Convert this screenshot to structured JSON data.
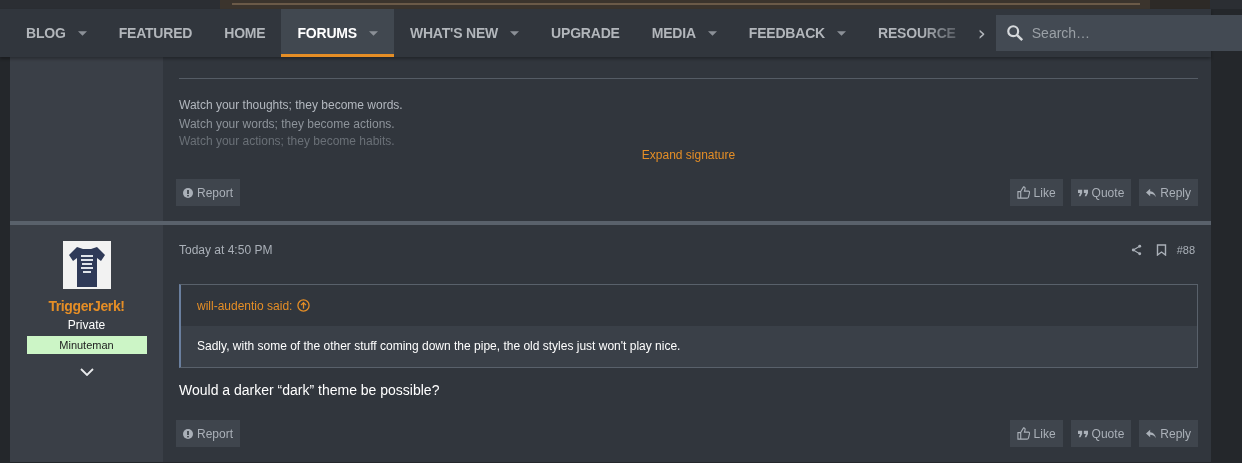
{
  "nav": {
    "items": [
      {
        "label": "BLOG",
        "has_menu": true,
        "selected": false
      },
      {
        "label": "FEATURED",
        "has_menu": false,
        "selected": false
      },
      {
        "label": "HOME",
        "has_menu": false,
        "selected": false
      },
      {
        "label": "FORUMS",
        "has_menu": true,
        "selected": true
      },
      {
        "label": "WHAT'S NEW",
        "has_menu": true,
        "selected": false
      },
      {
        "label": "UPGRADE",
        "has_menu": false,
        "selected": false
      },
      {
        "label": "MEDIA",
        "has_menu": true,
        "selected": false
      },
      {
        "label": "FEEDBACK",
        "has_menu": true,
        "selected": false
      },
      {
        "label": "RESOURCE",
        "has_menu": false,
        "selected": false
      }
    ],
    "more": "›",
    "search": {
      "placeholder": "Search…"
    }
  },
  "posts": [
    {
      "kind": "signature",
      "signature": [
        "Watch your thoughts; they become words.",
        "Watch your words; they become actions.",
        "Watch your actions; they become habits."
      ],
      "expand": "Expand signature",
      "report": "Report",
      "actions": [
        "Like",
        "Quote",
        "Reply"
      ]
    },
    {
      "kind": "post",
      "user": {
        "name": "TriggerJerk!",
        "rank": "Private",
        "banner": "Minuteman"
      },
      "time": "Today at 4:50 PM",
      "number": "#88",
      "quote": {
        "author": "will-audentio said:",
        "text": "Sadly, with some of the other stuff coming down the pipe, the old styles just won't play nice."
      },
      "body": "Would a darker “dark” theme be possible?",
      "report": "Report",
      "actions": [
        "Like",
        "Quote",
        "Reply"
      ]
    }
  ]
}
